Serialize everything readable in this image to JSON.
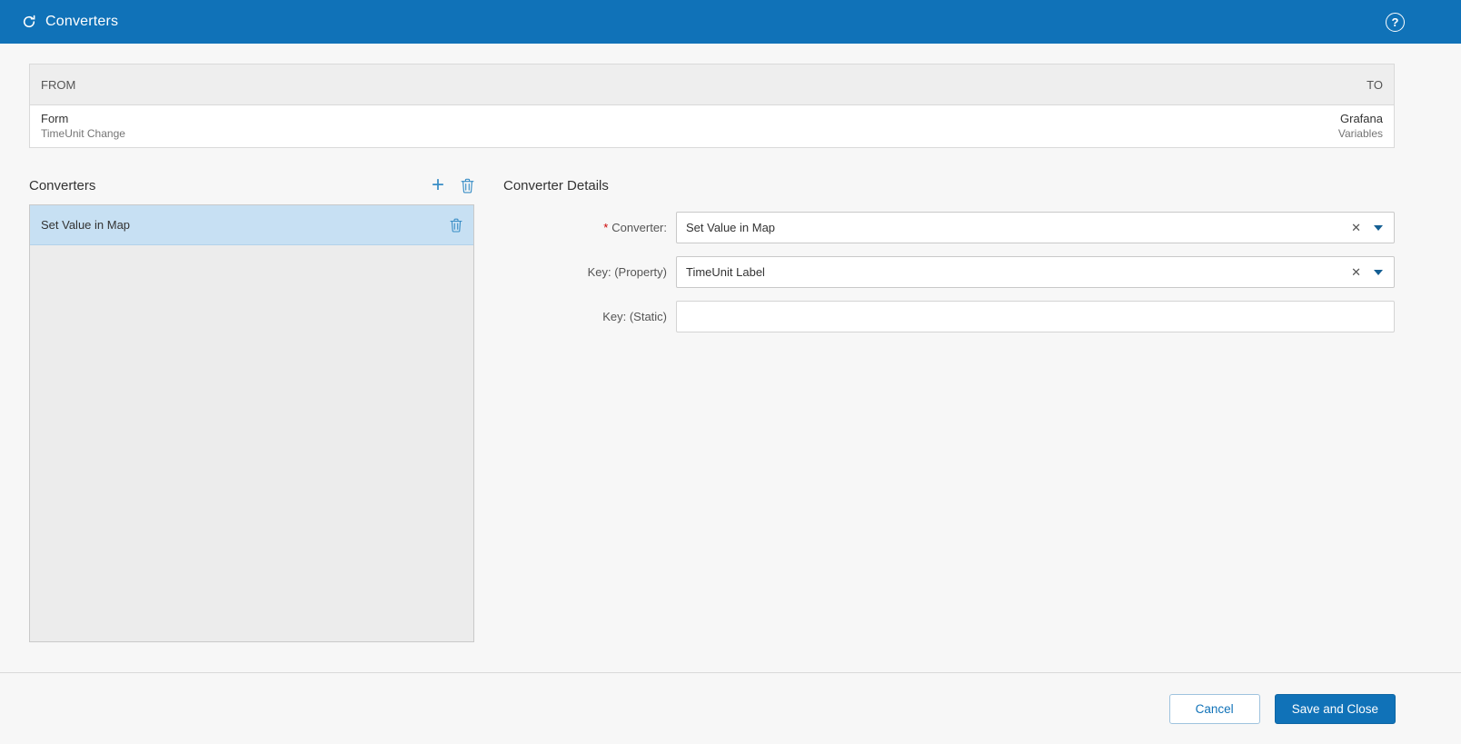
{
  "colors": {
    "accent": "#1072b8",
    "selected_row": "#c7e0f3",
    "required_marker_color": "#cc0000"
  },
  "icons": {
    "app": "sync-icon",
    "help": "help-icon",
    "add": "plus-icon",
    "delete": "trash-icon",
    "clear": "x-icon",
    "dropdown": "chevron-down-icon"
  },
  "header": {
    "title": "Converters"
  },
  "mapping_table": {
    "from_header": "FROM",
    "to_header": "TO",
    "from_primary": "Form",
    "from_secondary": "TimeUnit Change",
    "to_primary": "Grafana",
    "to_secondary": "Variables"
  },
  "converters_panel": {
    "title": "Converters",
    "items": [
      {
        "label": "Set Value in Map",
        "selected": true
      }
    ]
  },
  "details_panel": {
    "title": "Converter Details",
    "required_marker": "*",
    "clear_glyph": "✕",
    "fields": [
      {
        "label": "Converter:",
        "required": true,
        "value": "Set Value in Map",
        "type": "combobox"
      },
      {
        "label": "Key: (Property)",
        "required": false,
        "value": "TimeUnit Label",
        "type": "combobox"
      },
      {
        "label": "Key: (Static)",
        "required": false,
        "value": "",
        "type": "text"
      }
    ]
  },
  "footer": {
    "cancel": "Cancel",
    "save": "Save and Close"
  }
}
